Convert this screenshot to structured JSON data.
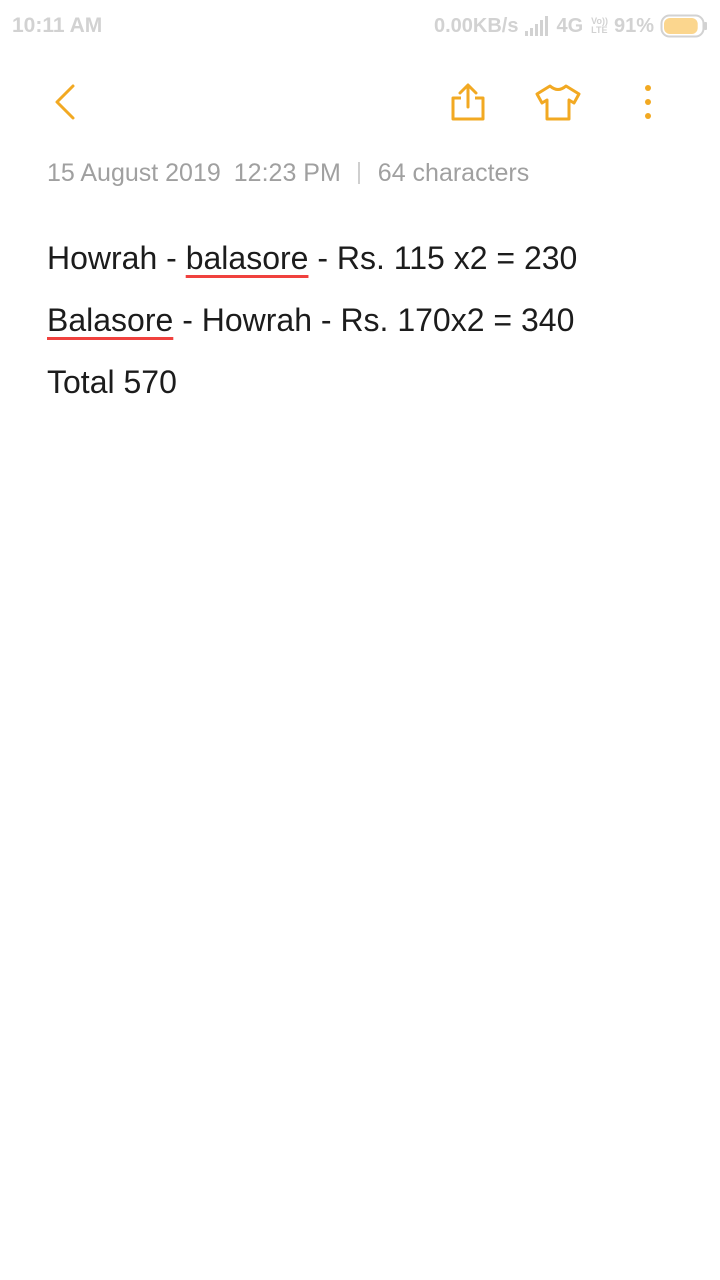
{
  "status_bar": {
    "time": "10:11 AM",
    "network_speed": "0.00KB/s",
    "network_type": "4G",
    "volte_top": "Vo))",
    "volte_bottom": "LTE",
    "battery": "91%",
    "battery_level_percent": 91,
    "icons": [
      "signal-icon",
      "battery-icon"
    ]
  },
  "toolbar": {
    "accent_color": "#f2a922",
    "icons": [
      "back-icon",
      "share-icon",
      "theme-icon",
      "more-icon"
    ]
  },
  "note": {
    "date": "15 August 2019",
    "time": "12:23 PM",
    "characters": "64 characters",
    "lines": [
      {
        "before": "Howrah - ",
        "flagged": "balasore",
        "after": " - Rs. 115 x2 = 230"
      },
      {
        "before": "",
        "flagged": "Balasore",
        "after": " - Howrah - Rs. 170x2 = 340"
      },
      {
        "before": "Total 570",
        "flagged": "",
        "after": ""
      }
    ],
    "spellcheck_color": "#f0413e"
  }
}
